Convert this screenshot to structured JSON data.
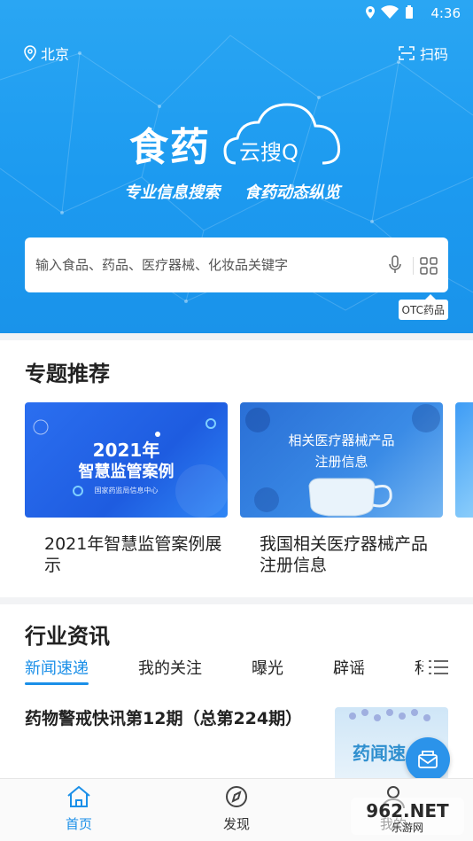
{
  "status": {
    "time": "4:36"
  },
  "header": {
    "location": "北京",
    "scan_label": "扫码"
  },
  "logo": {
    "main": "食药",
    "sub": "云搜Q",
    "slogan_left": "专业信息搜索",
    "slogan_right": "食药动态纵览"
  },
  "search": {
    "placeholder": "输入食品、药品、医疗器械、化妆品关键字",
    "otc_label": "OTC药品"
  },
  "topics": {
    "title": "专题推荐",
    "cards": [
      {
        "image_title": "2021年",
        "image_subtitle": "智慧监管案例",
        "image_footer": "国家药监局信息中心",
        "caption": "2021年智慧监管案例展示"
      },
      {
        "image_title": "相关医疗器械产品",
        "image_subtitle": "注册信息",
        "caption": "我国相关医疗器械产品注册信息"
      }
    ]
  },
  "news": {
    "title": "行业资讯",
    "tabs": [
      "新闻速递",
      "我的关注",
      "曝光",
      "辟谣",
      "科"
    ],
    "article": {
      "title": "药物警戒快讯第12期（总第224期）",
      "thumb_text": "药闻速"
    }
  },
  "bottom_nav": {
    "items": [
      {
        "label": "首页"
      },
      {
        "label": "发现"
      },
      {
        "label": "我的"
      }
    ]
  },
  "watermark": {
    "text": "962.NET",
    "sub": "乐游网"
  },
  "colors": {
    "brand": "#1a8fe8",
    "hero": "#2aa6f3"
  }
}
